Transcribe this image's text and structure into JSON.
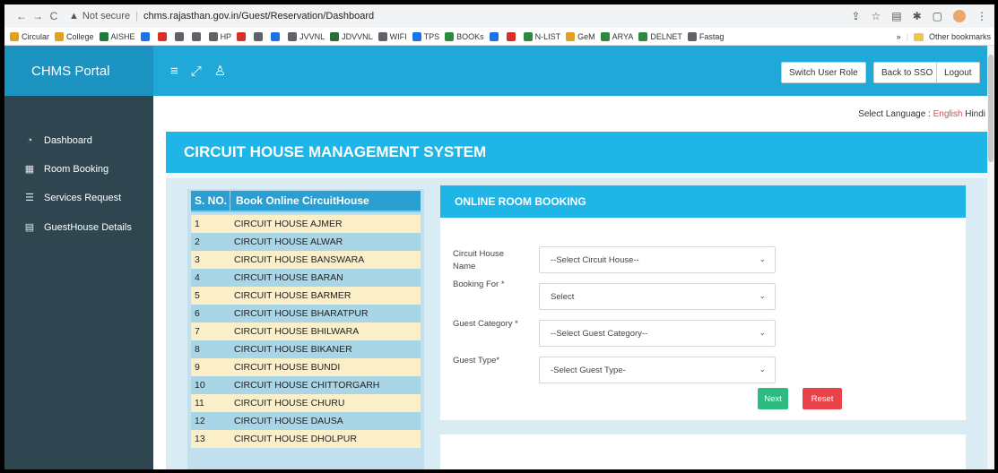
{
  "browser": {
    "not_secure": "Not secure",
    "url": "chms.rajasthan.gov.in/Guest/Reservation/Dashboard",
    "bookmarks": [
      {
        "label": "Circular",
        "color": "#e0a020"
      },
      {
        "label": "College",
        "color": "#e0a020"
      },
      {
        "label": "AISHE",
        "color": "#1d7a3a"
      },
      {
        "label": "",
        "color": "#1a73e8"
      },
      {
        "label": "",
        "color": "#d93025"
      },
      {
        "label": "",
        "color": "#5f6368"
      },
      {
        "label": "",
        "color": "#5f6368"
      },
      {
        "label": "HP",
        "color": "#5f6368"
      },
      {
        "label": "",
        "color": "#d93025"
      },
      {
        "label": "",
        "color": "#5f6368"
      },
      {
        "label": "",
        "color": "#1a73e8"
      },
      {
        "label": "JVVNL",
        "color": "#5f6368"
      },
      {
        "label": "JDVVNL",
        "color": "#2b6e3a"
      },
      {
        "label": "WIFI",
        "color": "#5f6368"
      },
      {
        "label": "TPS",
        "color": "#1a73e8"
      },
      {
        "label": "BOOKs",
        "color": "#2b8a3e"
      },
      {
        "label": "",
        "color": "#1a73e8"
      },
      {
        "label": "",
        "color": "#d93025"
      },
      {
        "label": "N-LIST",
        "color": "#2b8a3e"
      },
      {
        "label": "GeM",
        "color": "#e0a020"
      },
      {
        "label": "ARYA",
        "color": "#2b8a3e"
      },
      {
        "label": "DELNET",
        "color": "#2b8a3e"
      },
      {
        "label": "Fastag",
        "color": "#5f6368"
      }
    ],
    "more_chevron": "»",
    "other_bookmarks": "Other bookmarks"
  },
  "header": {
    "brand": "CHMS Portal",
    "switch_role": "Switch User Role",
    "back_sso": "Back to SSO",
    "logout": "Logout"
  },
  "sidebar": {
    "items": [
      {
        "label": "Dashboard",
        "icon": "dashboard-icon"
      },
      {
        "label": "Room Booking",
        "icon": "calendar-icon"
      },
      {
        "label": "Services Request",
        "icon": "list-icon"
      },
      {
        "label": "GuestHouse Details",
        "icon": "document-icon"
      }
    ]
  },
  "language": {
    "prefix": "Select Language : ",
    "english": "English",
    "hindi": "Hindi"
  },
  "page_title": "CIRCUIT HOUSE MANAGEMENT SYSTEM",
  "circuit_table": {
    "col_no": "S. NO.",
    "col_name": "Book Online CircuitHouse",
    "rows": [
      {
        "no": "1",
        "name": "CIRCUIT HOUSE AJMER"
      },
      {
        "no": "2",
        "name": "CIRCUIT HOUSE ALWAR"
      },
      {
        "no": "3",
        "name": "CIRCUIT HOUSE BANSWARA"
      },
      {
        "no": "4",
        "name": "CIRCUIT HOUSE BARAN"
      },
      {
        "no": "5",
        "name": "CIRCUIT HOUSE BARMER"
      },
      {
        "no": "6",
        "name": "CIRCUIT HOUSE BHARATPUR"
      },
      {
        "no": "7",
        "name": "CIRCUIT HOUSE BHILWARA"
      },
      {
        "no": "8",
        "name": "CIRCUIT HOUSE BIKANER"
      },
      {
        "no": "9",
        "name": "CIRCUIT HOUSE BUNDI"
      },
      {
        "no": "10",
        "name": "CIRCUIT HOUSE CHITTORGARH"
      },
      {
        "no": "11",
        "name": "CIRCUIT HOUSE CHURU"
      },
      {
        "no": "12",
        "name": "CIRCUIT HOUSE DAUSA"
      },
      {
        "no": "13",
        "name": "CIRCUIT HOUSE DHOLPUR"
      }
    ]
  },
  "booking": {
    "heading": "ONLINE ROOM BOOKING",
    "fields": [
      {
        "label": "Circuit House Name",
        "value": "--Select Circuit House--"
      },
      {
        "label": "Booking For *",
        "value": "Select"
      },
      {
        "label": "Guest Category *",
        "value": "--Select Guest Category--"
      },
      {
        "label": "Guest Type*",
        "value": "-Select Guest Type-"
      }
    ],
    "next": "Next",
    "reset": "Reset"
  }
}
